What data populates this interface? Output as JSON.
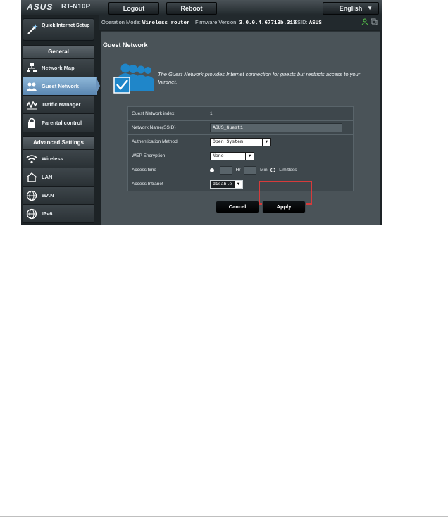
{
  "header": {
    "brand": "ASUS",
    "model": "RT-N10P",
    "logout_label": "Logout",
    "reboot_label": "Reboot",
    "language": "English"
  },
  "status": {
    "mode_label": "Operation Mode:",
    "mode_value": "Wireless router",
    "firmware_label": "Firmware Version:",
    "firmware_value": "3.0.0.4.67713b.313",
    "ssid_label": "SSID:",
    "ssid_value": "ASUS"
  },
  "sidebar": {
    "quick_setup": "Quick Internet Setup",
    "general_heading": "General",
    "general_items": [
      {
        "label": "Network Map",
        "icon": "network-map-icon"
      },
      {
        "label": "Guest Network",
        "icon": "guest-network-icon",
        "active": true
      },
      {
        "label": "Traffic Manager",
        "icon": "traffic-icon"
      },
      {
        "label": "Parental control",
        "icon": "lock-icon"
      }
    ],
    "advanced_heading": "Advanced Settings",
    "advanced_items": [
      {
        "label": "Wireless",
        "icon": "wifi-icon"
      },
      {
        "label": "LAN",
        "icon": "home-icon"
      },
      {
        "label": "WAN",
        "icon": "globe-icon"
      },
      {
        "label": "IPv6",
        "icon": "globe-icon"
      }
    ]
  },
  "main": {
    "title": "Guest Network",
    "description": "The Guest Network provides Internet connection for guests but restricts access to your Intranet.",
    "settings": {
      "index_label": "Guest Network index",
      "index_value": "1",
      "ssid_label": "Network Name(SSID)",
      "ssid_value": "ASUS_Guest1",
      "auth_label": "Authentication Method",
      "auth_value": "Open System",
      "wep_label": "WEP Encryption",
      "wep_value": "None",
      "time_label": "Access time",
      "hr_unit": "Hr",
      "min_unit": "Min",
      "limitless_label": "Limitless",
      "intranet_label": "Access Intranet",
      "intranet_value": "disable"
    },
    "cancel_label": "Cancel",
    "apply_label": "Apply"
  },
  "colors": {
    "highlight": "#d63b3b",
    "active_menu": "#6b93bb",
    "status_icon": "#55c34a"
  }
}
